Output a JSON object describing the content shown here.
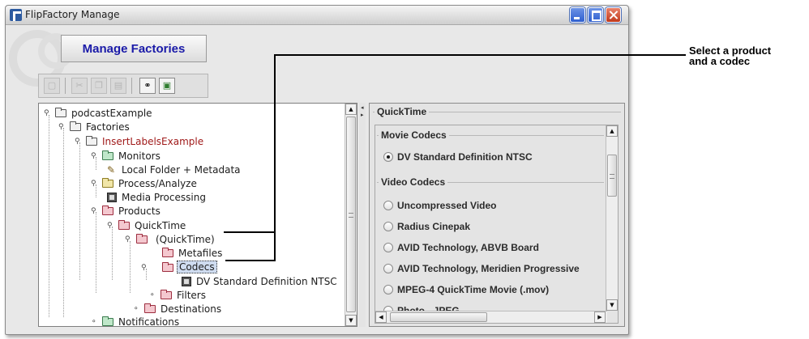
{
  "window": {
    "title": "FlipFactory Manage"
  },
  "banner": {
    "word1": "Manage",
    "word2": "Factories"
  },
  "toolbar": {
    "buttons": [
      {
        "icon": "document-icon",
        "enabled": false
      },
      {
        "icon": "cut-icon",
        "enabled": false
      },
      {
        "icon": "copy-icon",
        "enabled": false
      },
      {
        "icon": "paste-icon",
        "enabled": false
      },
      {
        "icon": "find-icon",
        "enabled": true,
        "glyph": "⚭"
      },
      {
        "icon": "map-icon",
        "enabled": true,
        "glyph": "▣"
      }
    ]
  },
  "tree": {
    "root": "podcastExample",
    "factories": "Factories",
    "factory": "InsertLabelsExample",
    "monitors": "Monitors",
    "local_folder": "Local Folder + Metadata",
    "process": "Process/Analyze",
    "media_processing": "Media Processing",
    "products": "Products",
    "quicktime": "QuickTime",
    "quicktime_paren": "(QuickTime)",
    "metafiles": "Metafiles",
    "codecs": "Codecs",
    "dv_ntsc": "DV Standard Definition NTSC",
    "filters": "Filters",
    "destinations": "Destinations",
    "notifications": "Notifications"
  },
  "settings_panel": {
    "title": "QuickTime",
    "movie_codecs_title": "Movie Codecs",
    "movie_codecs": [
      {
        "label": "DV Standard Definition NTSC",
        "selected": true
      }
    ],
    "video_codecs_title": "Video Codecs",
    "video_codecs": [
      {
        "label": "Uncompressed Video",
        "selected": false
      },
      {
        "label": "Radius Cinepak",
        "selected": false
      },
      {
        "label": "AVID Technology, ABVB Board",
        "selected": false
      },
      {
        "label": "AVID Technology, Meridien Progressive",
        "selected": false
      },
      {
        "label": "MPEG-4 QuickTime Movie (.mov)",
        "selected": false
      },
      {
        "label": "Photo - JPEG",
        "selected": false
      }
    ]
  },
  "callout": {
    "line1": "Select a product",
    "line2": "and a codec"
  }
}
